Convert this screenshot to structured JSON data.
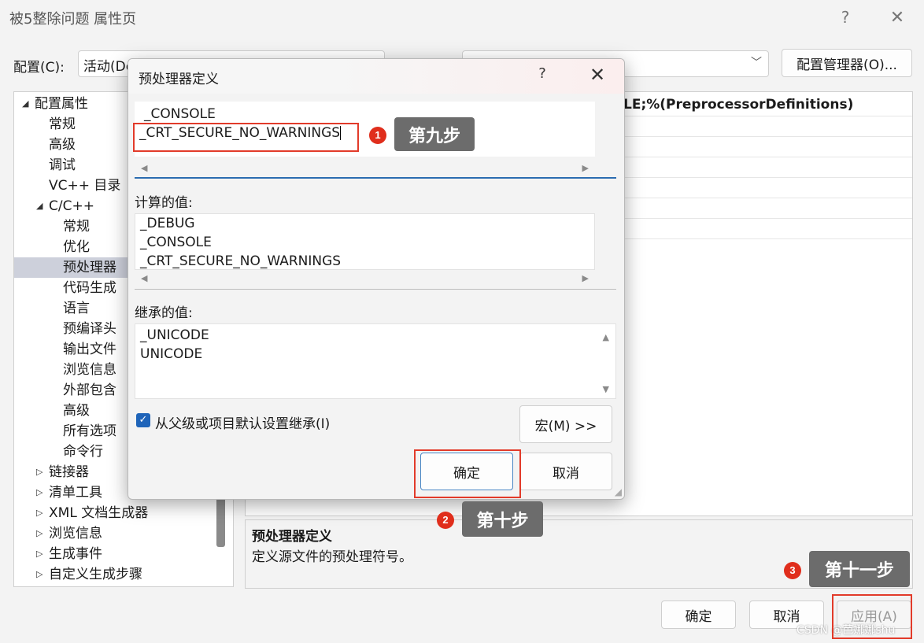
{
  "window": {
    "title": "被5整除问题 属性页",
    "help_glyph": "?",
    "close_glyph": "✕"
  },
  "config": {
    "label": "配置(C):",
    "value": "活动(De",
    "platform_value": "",
    "manager_button": "配置管理器(O)..."
  },
  "tree": {
    "items": [
      {
        "label": "配置属性",
        "level": 0,
        "expander": "◢"
      },
      {
        "label": "常规",
        "level": 1
      },
      {
        "label": "高级",
        "level": 1
      },
      {
        "label": "调试",
        "level": 1
      },
      {
        "label": "VC++ 目录",
        "level": 1
      },
      {
        "label": "C/C++",
        "level": 1,
        "expander": "◢"
      },
      {
        "label": "常规",
        "level": 2
      },
      {
        "label": "优化",
        "level": 2
      },
      {
        "label": "预处理器",
        "level": 2,
        "selected": true
      },
      {
        "label": "代码生成",
        "level": 2
      },
      {
        "label": "语言",
        "level": 2
      },
      {
        "label": "预编译头",
        "level": 2
      },
      {
        "label": "输出文件",
        "level": 2
      },
      {
        "label": "浏览信息",
        "level": 2
      },
      {
        "label": "外部包含",
        "level": 2
      },
      {
        "label": "高级",
        "level": 2
      },
      {
        "label": "所有选项",
        "level": 2
      },
      {
        "label": "命令行",
        "level": 2
      },
      {
        "label": "链接器",
        "level": 1,
        "expander": "▷"
      },
      {
        "label": "清单工具",
        "level": 1,
        "expander": "▷"
      },
      {
        "label": "XML 文档生成器",
        "level": 1,
        "expander": "▷"
      },
      {
        "label": "浏览信息",
        "level": 1,
        "expander": "▷"
      },
      {
        "label": "生成事件",
        "level": 1,
        "expander": "▷"
      },
      {
        "label": "自定义生成步骤",
        "level": 1,
        "expander": "▷"
      }
    ]
  },
  "grid": {
    "visible_value": "LE;%(PreprocessorDefinitions)"
  },
  "description": {
    "title": "预处理器定义",
    "text": "定义源文件的预处理符号。"
  },
  "main_buttons": {
    "ok": "确定",
    "cancel": "取消",
    "apply": "应用(A)"
  },
  "watermark": "CSDN @芭娜娜shu",
  "dialog": {
    "title": "预处理器定义",
    "help_glyph": "?",
    "close_glyph": "✕",
    "edit_lines": [
      "_CONSOLE",
      "_CRT_SECURE_NO_WARNINGS"
    ],
    "computed_label": "计算的值:",
    "computed_lines": [
      "_DEBUG",
      "_CONSOLE",
      "_CRT_SECURE_NO_WARNINGS"
    ],
    "inherited_label": "继承的值:",
    "inherited_lines": [
      "_UNICODE",
      "UNICODE"
    ],
    "inherit_checkbox_label": "从父级或项目默认设置继承(I)",
    "inherit_checked": true,
    "macro_button": "宏(M) >>",
    "ok_button": "确定",
    "cancel_button": "取消"
  },
  "annotations": [
    {
      "number": "1",
      "text": "第九步"
    },
    {
      "number": "2",
      "text": "第十步"
    },
    {
      "number": "3",
      "text": "第十一步"
    }
  ],
  "colors": {
    "accent": "#1f64b9",
    "annotation_red": "#e23b2a",
    "callout_gray": "#6c6c6c",
    "selection": "#cdd0db"
  },
  "icons": {
    "scroll_left": "◀",
    "scroll_right": "▶",
    "scroll_up": "▲",
    "scroll_down": "▼",
    "chevron_down": "﹀",
    "check": "✓"
  }
}
